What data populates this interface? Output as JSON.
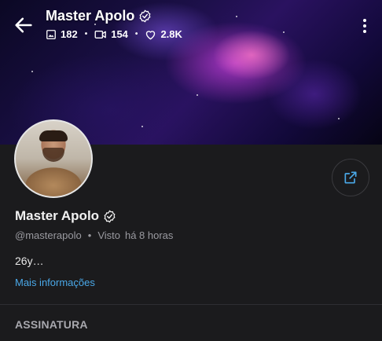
{
  "header": {
    "title": "Master Apolo",
    "stats": {
      "photos": "182",
      "videos": "154",
      "likes": "2.8K"
    }
  },
  "profile": {
    "name": "Master Apolo",
    "username": "@masterapolo",
    "seen_label": "Visto",
    "seen_time": "há 8 horas",
    "bio": "26y…",
    "more_info": "Mais informações"
  },
  "sections": {
    "subscription": "ASSINATURA"
  },
  "colors": {
    "accent": "#4aa8e8",
    "background": "#1b1b1d"
  }
}
